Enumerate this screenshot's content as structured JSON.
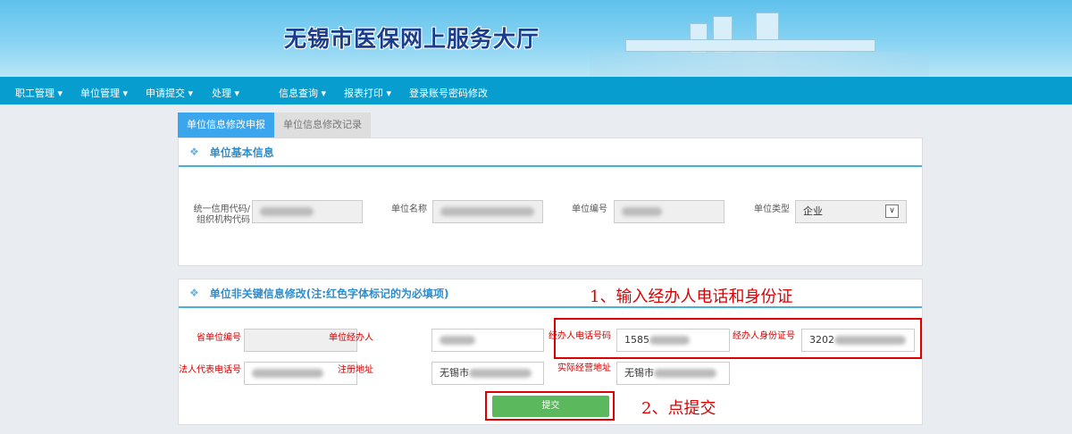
{
  "header": {
    "title": "无锡市医保网上服务大厅"
  },
  "nav": [
    {
      "label": "职工管理 ▾"
    },
    {
      "label": "单位管理 ▾"
    },
    {
      "label": "申请提交 ▾"
    },
    {
      "label": "处理 ▾"
    },
    {
      "label": "信息查询 ▾"
    },
    {
      "label": "报表打印 ▾"
    },
    {
      "label": "登录账号密码修改"
    }
  ],
  "tabs": [
    {
      "label": "单位信息修改申报"
    },
    {
      "label": "单位信息修改记录"
    }
  ],
  "basic": {
    "title": "单位基本信息",
    "fields": [
      {
        "label": "统一信用代码/组织机构代码"
      },
      {
        "label": "单位名称"
      },
      {
        "label": "单位编号"
      },
      {
        "label": "单位类型",
        "value": "企业"
      }
    ]
  },
  "nonkey": {
    "title": "单位非关键信息修改(注:红色字体标记的为必填项)",
    "fields": [
      {
        "label": "省单位编号",
        "value": ""
      },
      {
        "label": "单位经办人"
      },
      {
        "label": "经办人电话号码",
        "value": "1585"
      },
      {
        "label": "经办人身份证号",
        "value": "3202"
      },
      {
        "label": "法人代表电话号"
      },
      {
        "label": "注册地址",
        "value": "无锡市"
      },
      {
        "label": "实际经营地址",
        "value": "无锡市"
      }
    ]
  },
  "submit_label": "提交",
  "annotations": {
    "step1": "1、输入经办人电话和身份证",
    "step2": "2、点提交"
  }
}
